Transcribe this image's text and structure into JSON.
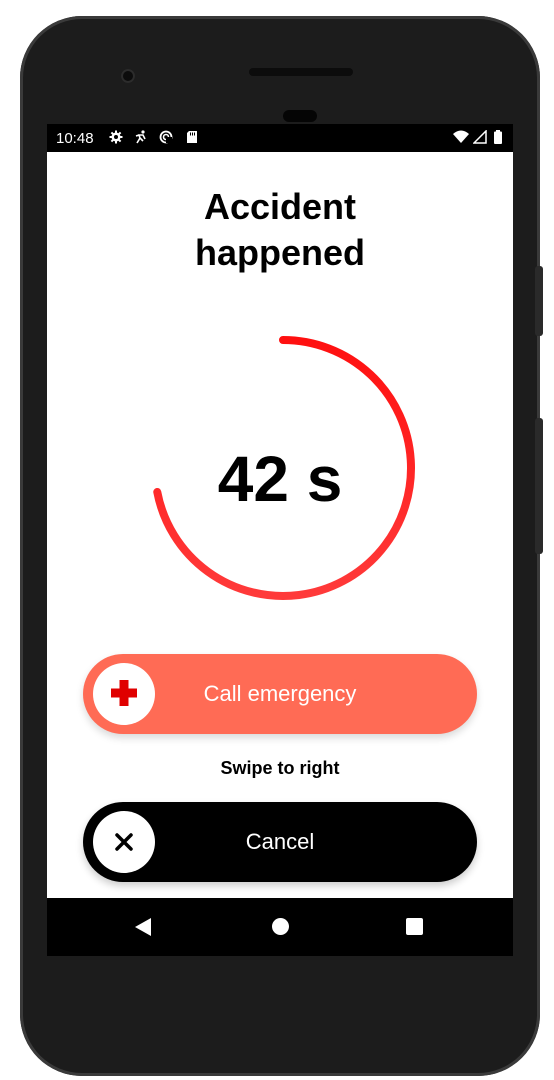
{
  "status_bar": {
    "time": "10:48",
    "left_icons": [
      "gear-icon",
      "accessibility-icon",
      "sync-icon",
      "sd-card-icon"
    ],
    "right_icons": [
      "wifi-icon",
      "signal-icon",
      "battery-icon"
    ]
  },
  "alert": {
    "title_line1": "Accident",
    "title_line2": "happened",
    "countdown": "42 s",
    "countdown_fraction": 0.72,
    "ring_color": "#ff1a1a"
  },
  "emergency_button": {
    "label": "Call emergency",
    "icon": "red-cross-icon",
    "color": "#ff6b55"
  },
  "hint": "Swipe to right",
  "cancel_button": {
    "label": "Cancel",
    "icon": "close-icon",
    "color": "#000000"
  },
  "nav_bar": {
    "icons": [
      "back-icon",
      "home-icon",
      "recents-icon"
    ]
  }
}
